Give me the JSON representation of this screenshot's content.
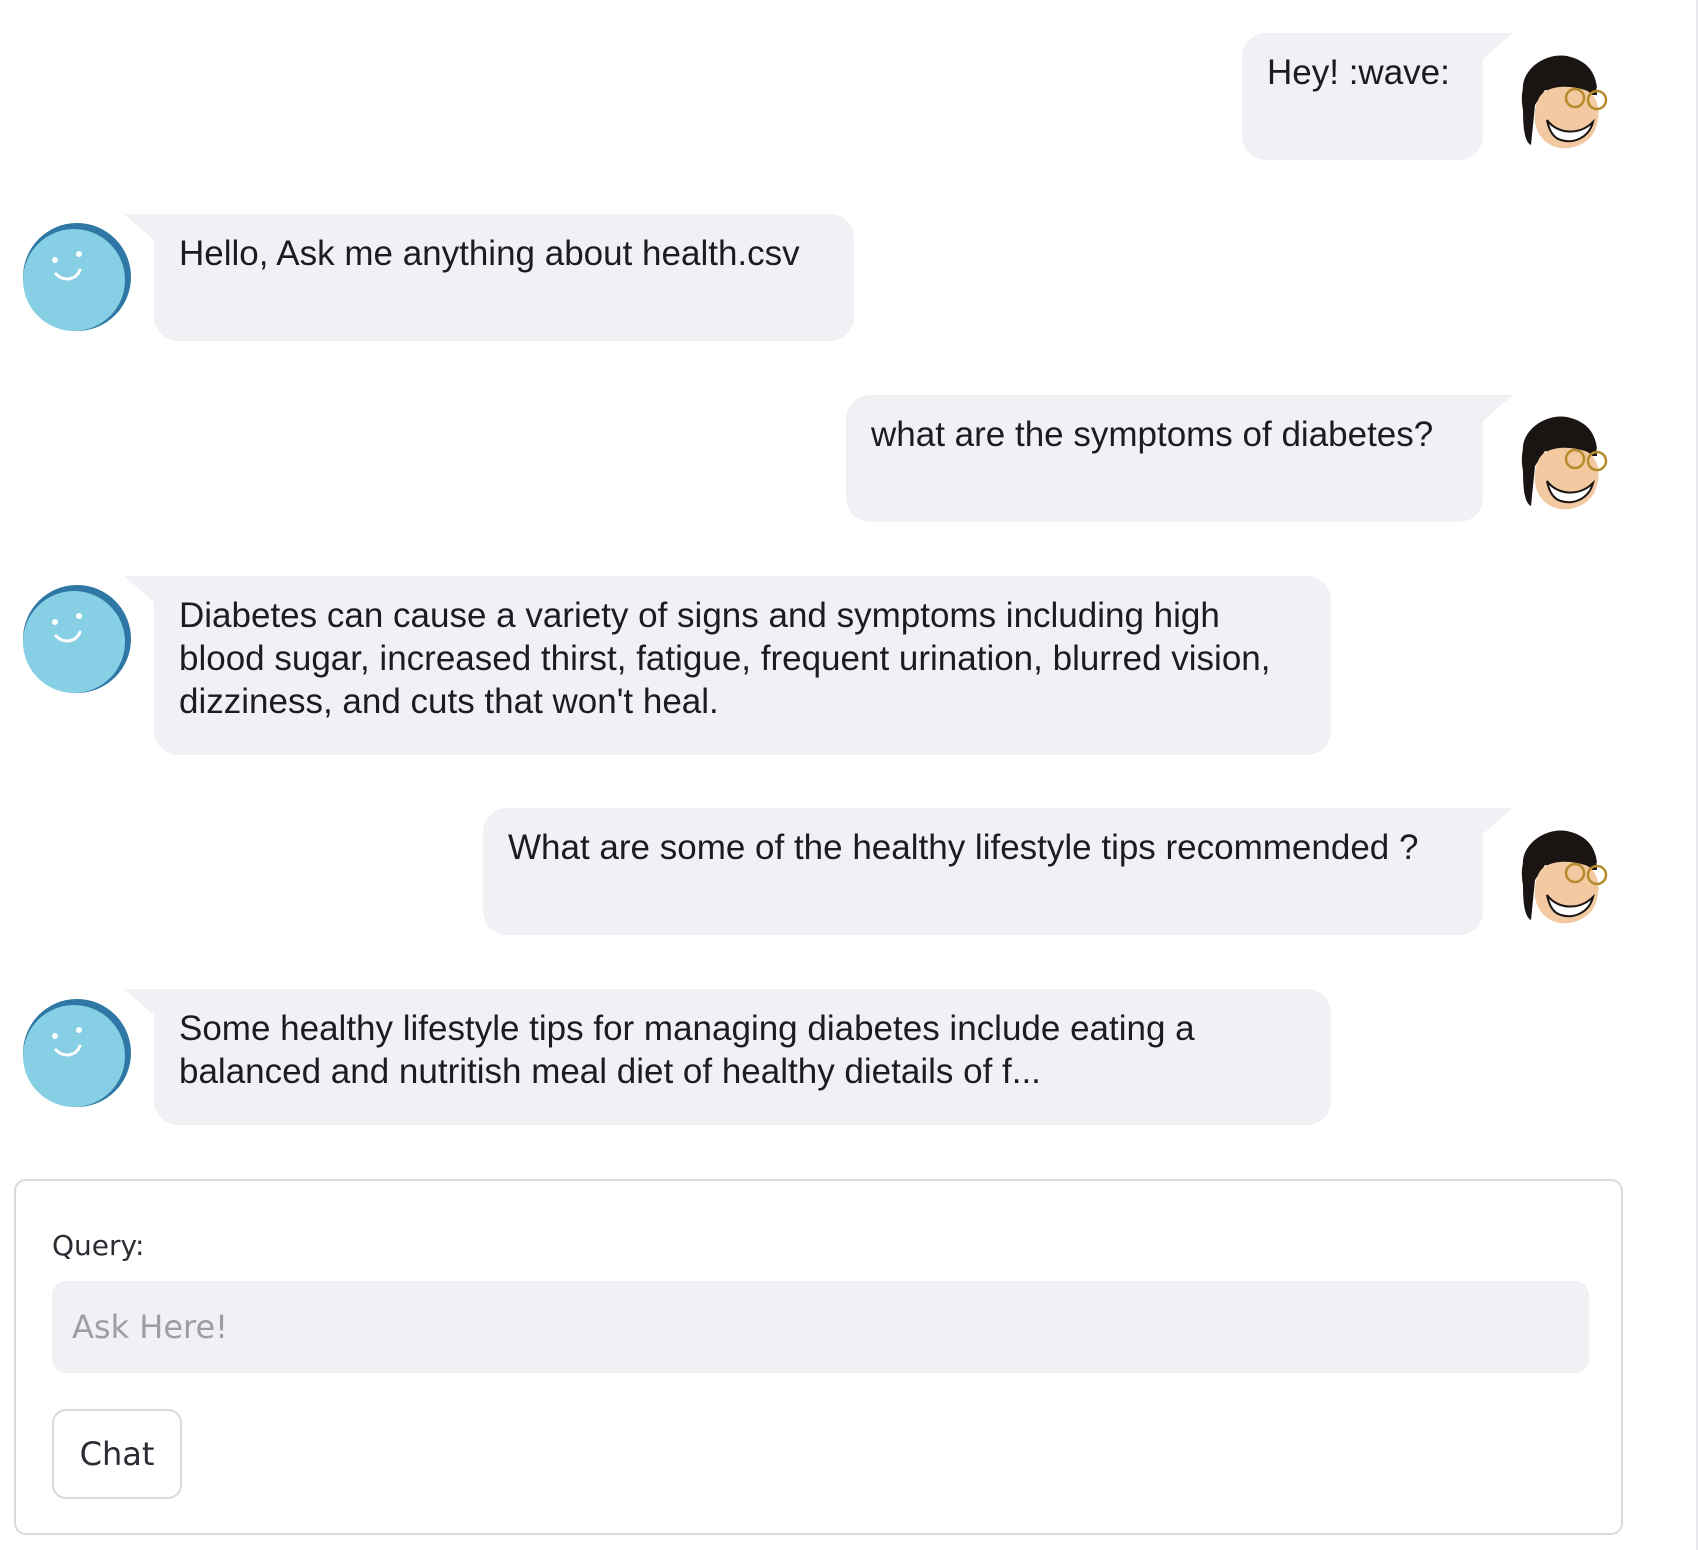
{
  "messages": [
    {
      "role": "user",
      "text": "Hey! :wave:",
      "avatar_icon": "user-avatar-icon"
    },
    {
      "role": "bot",
      "text": "Hello, Ask me anything about health.csv",
      "avatar_icon": "bot-avatar-icon"
    },
    {
      "role": "user",
      "text": "what are the symptoms of diabetes?",
      "avatar_icon": "user-avatar-icon"
    },
    {
      "role": "bot",
      "text": "Diabetes can cause a variety of signs and symptoms including high blood sugar, increased thirst, fatigue, frequent urination, blurred vision, dizziness, and cuts that won't heal.",
      "avatar_icon": "bot-avatar-icon"
    },
    {
      "role": "user",
      "text": "What are some of the healthy lifestyle tips recommended ?",
      "avatar_icon": "user-avatar-icon"
    },
    {
      "role": "bot",
      "text": "Some healthy lifestyle tips for managing diabetes include eating a balanced and nutritish meal diet of healthy dietails of f...",
      "avatar_icon": "bot-avatar-icon"
    }
  ],
  "form": {
    "label": "Query:",
    "placeholder": "Ask Here!",
    "value": "",
    "submit_label": "Chat"
  },
  "colors": {
    "bubble_bg": "#f0f1f5",
    "bot_avatar": "#86cfe4",
    "bot_avatar_ring": "#2f77a4",
    "border": "#d9dadf"
  }
}
